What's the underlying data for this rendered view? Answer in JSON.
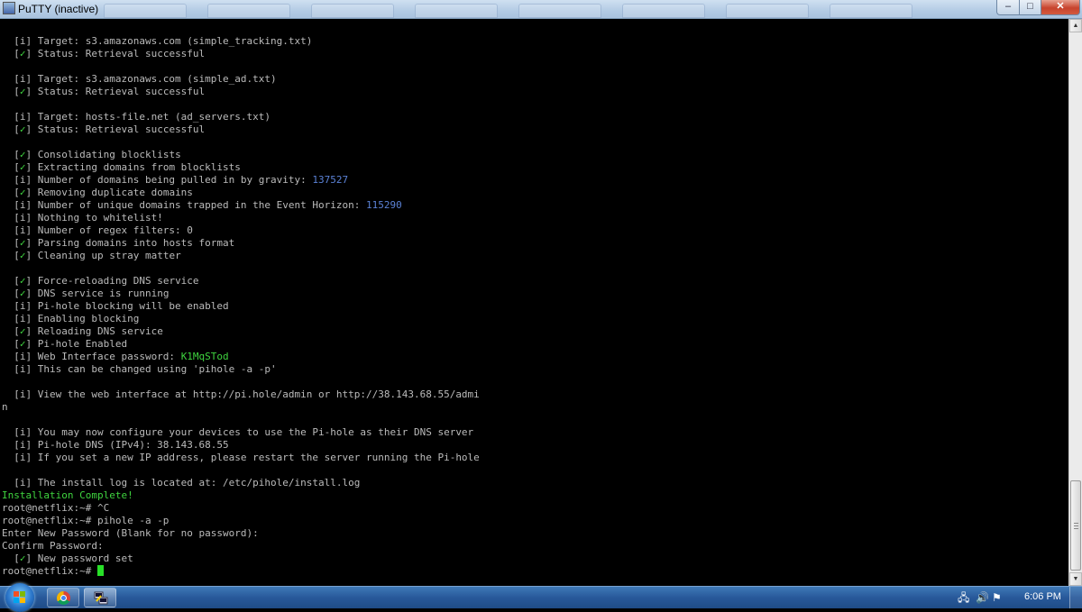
{
  "window": {
    "title": "PuTTY (inactive)"
  },
  "controls": {
    "minimize": "–",
    "maximize": "□",
    "close": "✕"
  },
  "terminal": {
    "lines": [
      {
        "segments": [
          {
            "t": "  [i] Target: s3.amazonaws.com (simple_tracking.txt)"
          }
        ]
      },
      {
        "segments": [
          {
            "t": "  ["
          },
          {
            "t": "✓",
            "c": "g"
          },
          {
            "t": "] Status: Retrieval successful"
          }
        ]
      },
      {
        "segments": []
      },
      {
        "segments": [
          {
            "t": "  [i] Target: s3.amazonaws.com (simple_ad.txt)"
          }
        ]
      },
      {
        "segments": [
          {
            "t": "  ["
          },
          {
            "t": "✓",
            "c": "g"
          },
          {
            "t": "] Status: Retrieval successful"
          }
        ]
      },
      {
        "segments": []
      },
      {
        "segments": [
          {
            "t": "  [i] Target: hosts-file.net (ad_servers.txt)"
          }
        ]
      },
      {
        "segments": [
          {
            "t": "  ["
          },
          {
            "t": "✓",
            "c": "g"
          },
          {
            "t": "] Status: Retrieval successful"
          }
        ]
      },
      {
        "segments": []
      },
      {
        "segments": [
          {
            "t": "  ["
          },
          {
            "t": "✓",
            "c": "g"
          },
          {
            "t": "] Consolidating blocklists"
          }
        ]
      },
      {
        "segments": [
          {
            "t": "  ["
          },
          {
            "t": "✓",
            "c": "g"
          },
          {
            "t": "] Extracting domains from blocklists"
          }
        ]
      },
      {
        "segments": [
          {
            "t": "  [i] Number of domains being pulled in by gravity: "
          },
          {
            "t": "137527",
            "c": "b"
          }
        ]
      },
      {
        "segments": [
          {
            "t": "  ["
          },
          {
            "t": "✓",
            "c": "g"
          },
          {
            "t": "] Removing duplicate domains"
          }
        ]
      },
      {
        "segments": [
          {
            "t": "  [i] Number of unique domains trapped in the Event Horizon: "
          },
          {
            "t": "115290",
            "c": "b"
          }
        ]
      },
      {
        "segments": [
          {
            "t": "  [i] Nothing to whitelist!"
          }
        ]
      },
      {
        "segments": [
          {
            "t": "  [i] Number of regex filters: 0"
          }
        ]
      },
      {
        "segments": [
          {
            "t": "  ["
          },
          {
            "t": "✓",
            "c": "g"
          },
          {
            "t": "] Parsing domains into hosts format"
          }
        ]
      },
      {
        "segments": [
          {
            "t": "  ["
          },
          {
            "t": "✓",
            "c": "g"
          },
          {
            "t": "] Cleaning up stray matter"
          }
        ]
      },
      {
        "segments": []
      },
      {
        "segments": [
          {
            "t": "  ["
          },
          {
            "t": "✓",
            "c": "g"
          },
          {
            "t": "] Force-reloading DNS service"
          }
        ]
      },
      {
        "segments": [
          {
            "t": "  ["
          },
          {
            "t": "✓",
            "c": "g"
          },
          {
            "t": "] DNS service is running"
          }
        ]
      },
      {
        "segments": [
          {
            "t": "  [i] Pi-hole blocking will be enabled"
          }
        ]
      },
      {
        "segments": [
          {
            "t": "  [i] Enabling blocking"
          }
        ]
      },
      {
        "segments": [
          {
            "t": "  ["
          },
          {
            "t": "✓",
            "c": "g"
          },
          {
            "t": "] Reloading DNS service"
          }
        ]
      },
      {
        "segments": [
          {
            "t": "  ["
          },
          {
            "t": "✓",
            "c": "g"
          },
          {
            "t": "] Pi-hole Enabled"
          }
        ]
      },
      {
        "segments": [
          {
            "t": "  [i] Web Interface password: "
          },
          {
            "t": "K1MqSTod",
            "c": "g"
          }
        ]
      },
      {
        "segments": [
          {
            "t": "  [i] This can be changed using 'pihole -a -p'"
          }
        ]
      },
      {
        "segments": []
      },
      {
        "segments": [
          {
            "t": "  [i] View the web interface at http://pi.hole/admin or http://38.143.68.55/admi"
          }
        ]
      },
      {
        "segments": [
          {
            "t": "n"
          }
        ]
      },
      {
        "segments": []
      },
      {
        "segments": [
          {
            "t": "  [i] You may now configure your devices to use the Pi-hole as their DNS server"
          }
        ]
      },
      {
        "segments": [
          {
            "t": "  [i] Pi-hole DNS (IPv4): 38.143.68.55"
          }
        ]
      },
      {
        "segments": [
          {
            "t": "  [i] If you set a new IP address, please restart the server running the Pi-hole"
          }
        ]
      },
      {
        "segments": []
      },
      {
        "segments": [
          {
            "t": "  [i] The install log is located at: /etc/pihole/install.log"
          }
        ]
      },
      {
        "segments": [
          {
            "t": "Installation Complete!",
            "c": "g"
          }
        ]
      },
      {
        "segments": [
          {
            "t": "root@netflix:~# ^C"
          }
        ]
      },
      {
        "segments": [
          {
            "t": "root@netflix:~# pihole -a -p"
          }
        ]
      },
      {
        "segments": [
          {
            "t": "Enter New Password (Blank for no password):"
          }
        ]
      },
      {
        "segments": [
          {
            "t": "Confirm Password:"
          }
        ]
      },
      {
        "segments": [
          {
            "t": "  ["
          },
          {
            "t": "✓",
            "c": "g"
          },
          {
            "t": "] New password set"
          }
        ]
      },
      {
        "segments": [
          {
            "t": "root@netflix:~# "
          }
        ],
        "cursor": true
      }
    ]
  },
  "colors": {
    "background": "#000000",
    "text": "#bbbbbb",
    "green": "#3fd43f",
    "blue": "#5b82d6"
  },
  "taskbar": {
    "apps": [
      {
        "name": "chrome-icon"
      },
      {
        "name": "putty-icon"
      }
    ],
    "clock": "6:06 PM"
  }
}
